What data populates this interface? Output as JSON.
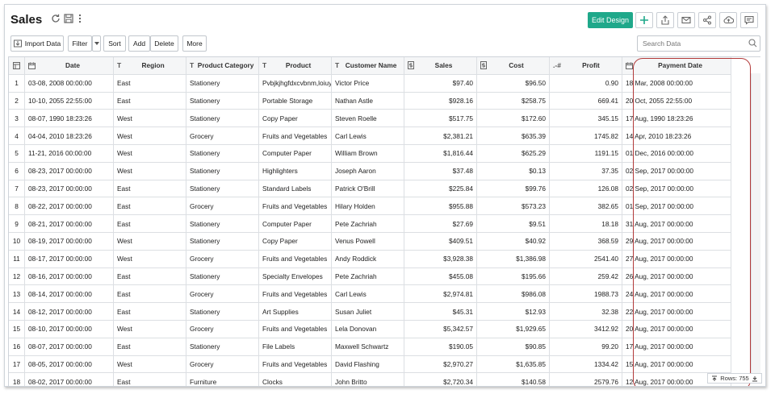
{
  "window": {
    "title": "Sales"
  },
  "header_actions": {
    "edit_design": "Edit Design",
    "icons": [
      "add-icon",
      "export-icon",
      "email-icon",
      "share-icon",
      "cloud-upload-icon",
      "comment-icon"
    ]
  },
  "toolbar": {
    "import_data": "Import Data",
    "filter": "Filter",
    "sort": "Sort",
    "add": "Add",
    "delete": "Delete",
    "more": "More"
  },
  "search": {
    "placeholder": "Search Data"
  },
  "columns": [
    {
      "label": "Date",
      "type": "date"
    },
    {
      "label": "Region",
      "type": "text"
    },
    {
      "label": "Product Category",
      "type": "text"
    },
    {
      "label": "Product",
      "type": "text"
    },
    {
      "label": "Customer Name",
      "type": "text"
    },
    {
      "label": "Sales",
      "type": "currency"
    },
    {
      "label": "Cost",
      "type": "currency"
    },
    {
      "label": "Profit",
      "type": "number"
    },
    {
      "label": "Payment Date",
      "type": "date"
    }
  ],
  "column_type_glyphs": {
    "text": "T",
    "number": "#",
    "number_prefix": ".-"
  },
  "rows": [
    [
      "1",
      "03-08, 2008 00:00:00",
      "East",
      "Stationery",
      "Pvbjkjhgfdxcvbnm,loiuyh",
      "Victor Price",
      "$97.40",
      "$96.50",
      "0.90",
      "18 Mar, 2008 00:00:00"
    ],
    [
      "2",
      "10-10, 2055 22:55:00",
      "East",
      "Stationery",
      "Portable Storage",
      "Nathan Astle",
      "$928.16",
      "$258.75",
      "669.41",
      "20 Oct, 2055 22:55:00"
    ],
    [
      "3",
      "08-07, 1990 18:23:26",
      "West",
      "Stationery",
      "Copy Paper",
      "Steven Roelle",
      "$517.75",
      "$172.60",
      "345.15",
      "17 Aug, 1990 18:23:26"
    ],
    [
      "4",
      "04-04, 2010 18:23:26",
      "West",
      "Grocery",
      "Fruits and Vegetables",
      "Carl Lewis",
      "$2,381.21",
      "$635.39",
      "1745.82",
      "14 Apr, 2010 18:23:26"
    ],
    [
      "5",
      "11-21, 2016 00:00:00",
      "West",
      "Stationery",
      "Computer Paper",
      "William Brown",
      "$1,816.44",
      "$625.29",
      "1191.15",
      "01 Dec, 2016 00:00:00"
    ],
    [
      "6",
      "08-23, 2017 00:00:00",
      "West",
      "Stationery",
      "Highlighters",
      "Joseph Aaron",
      "$37.48",
      "$0.13",
      "37.35",
      "02 Sep, 2017 00:00:00"
    ],
    [
      "7",
      "08-23, 2017 00:00:00",
      "East",
      "Stationery",
      "Standard Labels",
      "Patrick O'Brill",
      "$225.84",
      "$99.76",
      "126.08",
      "02 Sep, 2017 00:00:00"
    ],
    [
      "8",
      "08-22, 2017 00:00:00",
      "East",
      "Grocery",
      "Fruits and Vegetables",
      "Hilary Holden",
      "$955.88",
      "$573.23",
      "382.65",
      "01 Sep, 2017 00:00:00"
    ],
    [
      "9",
      "08-21, 2017 00:00:00",
      "East",
      "Stationery",
      "Computer Paper",
      "Pete Zachriah",
      "$27.69",
      "$9.51",
      "18.18",
      "31 Aug, 2017 00:00:00"
    ],
    [
      "10",
      "08-19, 2017 00:00:00",
      "West",
      "Stationery",
      "Copy Paper",
      "Venus Powell",
      "$409.51",
      "$40.92",
      "368.59",
      "29 Aug, 2017 00:00:00"
    ],
    [
      "11",
      "08-17, 2017 00:00:00",
      "West",
      "Grocery",
      "Fruits and Vegetables",
      "Andy Roddick",
      "$3,928.38",
      "$1,386.98",
      "2541.40",
      "27 Aug, 2017 00:00:00"
    ],
    [
      "12",
      "08-16, 2017 00:00:00",
      "East",
      "Stationery",
      "Specialty Envelopes",
      "Pete Zachriah",
      "$455.08",
      "$195.66",
      "259.42",
      "26 Aug, 2017 00:00:00"
    ],
    [
      "13",
      "08-14, 2017 00:00:00",
      "East",
      "Grocery",
      "Fruits and Vegetables",
      "Carl Lewis",
      "$2,974.81",
      "$986.08",
      "1988.73",
      "24 Aug, 2017 00:00:00"
    ],
    [
      "14",
      "08-12, 2017 00:00:00",
      "East",
      "Stationery",
      "Art Supplies",
      "Susan Juliet",
      "$45.31",
      "$12.93",
      "32.38",
      "22 Aug, 2017 00:00:00"
    ],
    [
      "15",
      "08-10, 2017 00:00:00",
      "West",
      "Grocery",
      "Fruits and Vegetables",
      "Lela Donovan",
      "$5,342.57",
      "$1,929.65",
      "3412.92",
      "20 Aug, 2017 00:00:00"
    ],
    [
      "16",
      "08-07, 2017 00:00:00",
      "East",
      "Stationery",
      "File Labels",
      "Maxwell Schwartz",
      "$190.05",
      "$90.85",
      "99.20",
      "17 Aug, 2017 00:00:00"
    ],
    [
      "17",
      "08-05, 2017 00:00:00",
      "West",
      "Grocery",
      "Fruits and Vegetables",
      "David Flashing",
      "$2,970.27",
      "$1,635.85",
      "1334.42",
      "15 Aug, 2017 00:00:00"
    ],
    [
      "18",
      "08-02, 2017 00:00:00",
      "East",
      "Furniture",
      "Clocks",
      "John Britto",
      "$2,720.34",
      "$140.58",
      "2579.76",
      "12 Aug, 2017 00:00:00"
    ]
  ],
  "footer": {
    "rows_label": "Rows: 755"
  },
  "colors": {
    "accent": "#1fa88a",
    "highlight": "#b23a3a"
  }
}
